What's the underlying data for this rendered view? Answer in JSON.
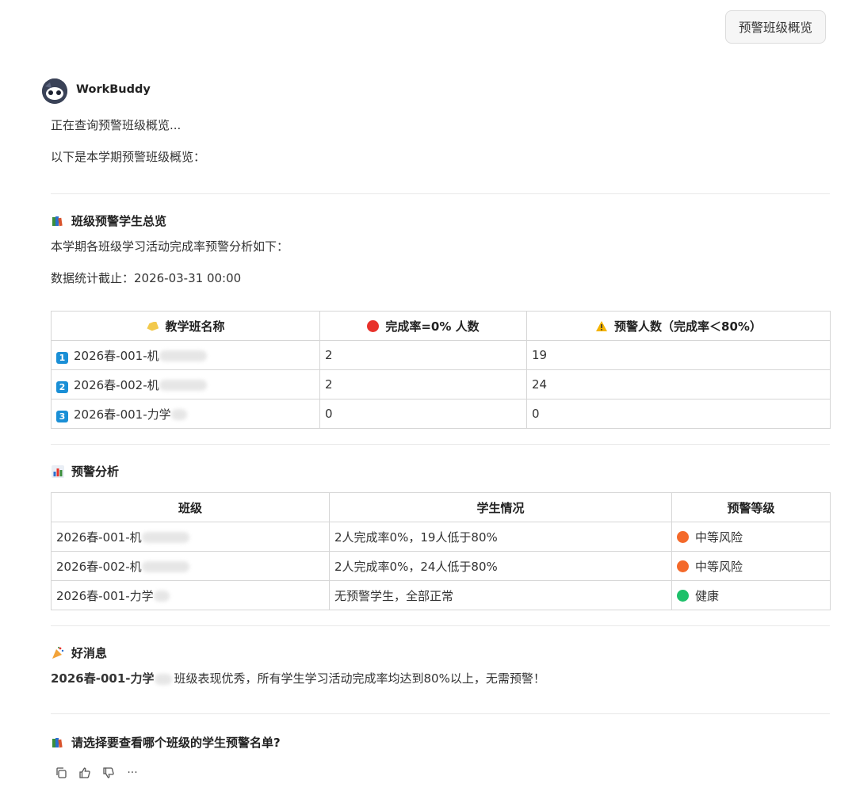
{
  "top_button": "预警班级概览",
  "sender": "WorkBuddy",
  "messages": {
    "loading": "正在查询预警班级概览...",
    "intro": "以下是本学期预警班级概览："
  },
  "overview": {
    "title": "班级预警学生总览",
    "desc": "本学期各班级学习活动完成率预警分析如下：",
    "cutoff": "数据统计截止：2026-03-31 00:00",
    "headers": [
      "教学班名称",
      "完成率=0% 人数",
      "预警人数（完成率＜80%）"
    ],
    "rows": [
      {
        "badge": "1",
        "name": "2026春-001-机",
        "zero": "2",
        "warn": "19"
      },
      {
        "badge": "2",
        "name": "2026春-002-机",
        "zero": "2",
        "warn": "24"
      },
      {
        "badge": "3",
        "name": "2026春-001-力学",
        "zero": "0",
        "warn": "0"
      }
    ]
  },
  "analysis": {
    "title": "预警分析",
    "headers": [
      "班级",
      "学生情况",
      "预警等级"
    ],
    "rows": [
      {
        "name": "2026春-001-机",
        "status": "2人完成率0%，19人低于80%",
        "level": "中等风险",
        "color": "#f4692a"
      },
      {
        "name": "2026春-002-机",
        "status": "2人完成率0%，24人低于80%",
        "level": "中等风险",
        "color": "#f4692a"
      },
      {
        "name": "2026春-001-力学",
        "status": "无预警学生，全部正常",
        "level": "健康",
        "color": "#1ec06a"
      }
    ]
  },
  "good_news": {
    "title": "好消息",
    "class_name": "2026春-001-力学",
    "text": "班级表现优秀，所有学生学习活动完成率均达到80%以上，无需预警！"
  },
  "question": "请选择要查看哪个班级的学生预警名单?",
  "actions": [
    "copy-icon",
    "thumbs-up-icon",
    "thumbs-down-icon",
    "more-icon"
  ],
  "action_more": "···"
}
